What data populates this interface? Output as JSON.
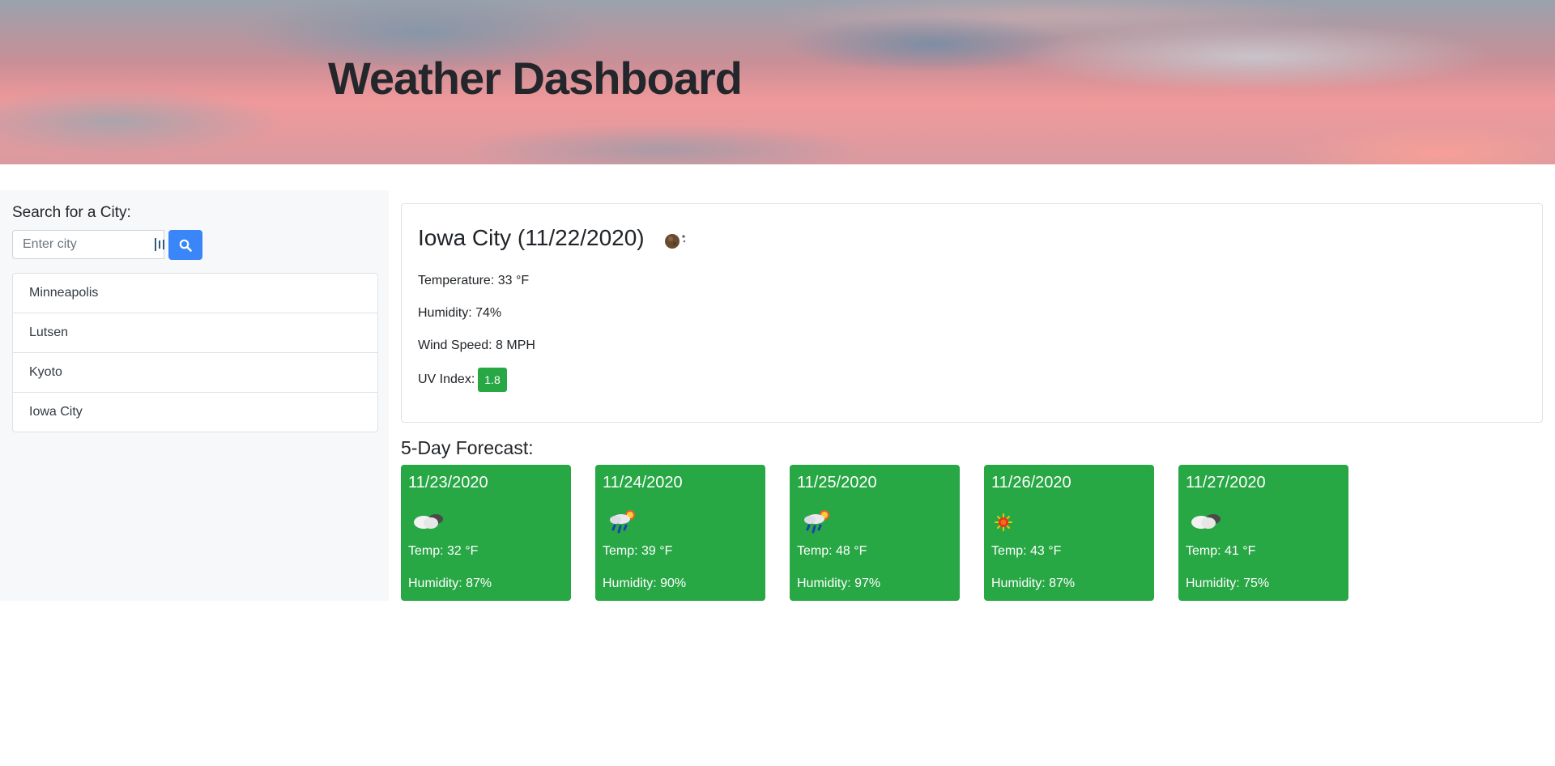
{
  "header": {
    "title": "Weather Dashboard"
  },
  "search": {
    "label": "Search for a City:",
    "placeholder": "Enter city",
    "value": "",
    "button_icon": "search-icon"
  },
  "history": [
    "Minneapolis",
    "Lutsen",
    "Kyoto",
    "Iowa City"
  ],
  "current": {
    "title": "Iowa City (11/22/2020)",
    "icon": "moon-icon",
    "temperature": "Temperature: 33 °F",
    "humidity": "Humidity: 74%",
    "wind": "Wind Speed: 8 MPH",
    "uv_label": "UV Index:",
    "uv_value": "1.8",
    "uv_color": "#28a745"
  },
  "forecast": {
    "heading": "5-Day Forecast:",
    "card_color": "#28a745",
    "days": [
      {
        "date": "11/23/2020",
        "icon": "cloudy-icon",
        "temp": "Temp: 32 °F",
        "humidity": "Humidity: 87%"
      },
      {
        "date": "11/24/2020",
        "icon": "rain-sun-icon",
        "temp": "Temp: 39 °F",
        "humidity": "Humidity: 90%"
      },
      {
        "date": "11/25/2020",
        "icon": "rain-sun-icon",
        "temp": "Temp: 48 °F",
        "humidity": "Humidity: 97%"
      },
      {
        "date": "11/26/2020",
        "icon": "sun-icon",
        "temp": "Temp: 43 °F",
        "humidity": "Humidity: 87%"
      },
      {
        "date": "11/27/2020",
        "icon": "cloudy-icon",
        "temp": "Temp: 41 °F",
        "humidity": "Humidity: 75%"
      }
    ]
  }
}
